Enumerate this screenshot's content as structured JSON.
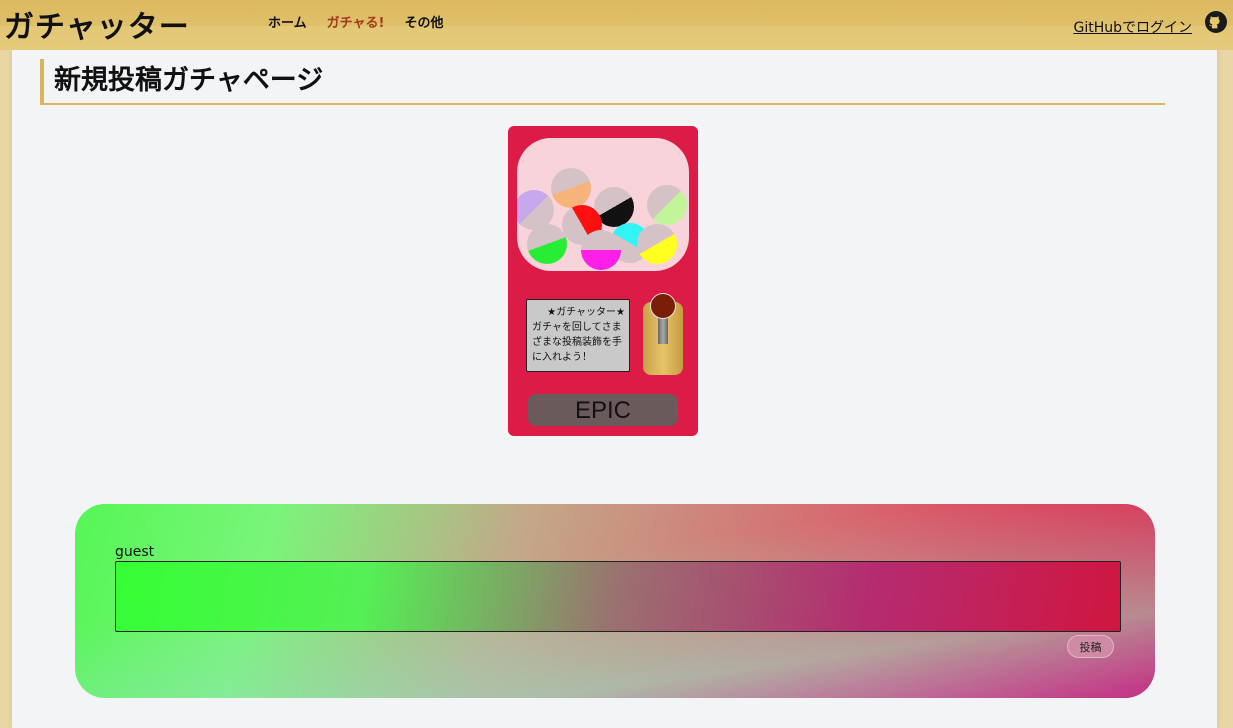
{
  "header": {
    "brand": "ガチャッター",
    "nav": [
      "ホーム",
      "ガチャる!",
      "その他"
    ],
    "login_label": "GitHubでログイン",
    "github_icon": "github-icon"
  },
  "page": {
    "title": "新規投稿ガチャページ"
  },
  "machine": {
    "info_title": "★ガチャッター★",
    "info_text": "ガチャを回してさまざまな投稿装飾を手に入れよう！",
    "rarity": "EPIC",
    "colors": {
      "body": "#dc1b47",
      "globe": "#f9d3da"
    }
  },
  "post": {
    "username": "guest",
    "text_value": "",
    "submit_label": "投稿"
  }
}
